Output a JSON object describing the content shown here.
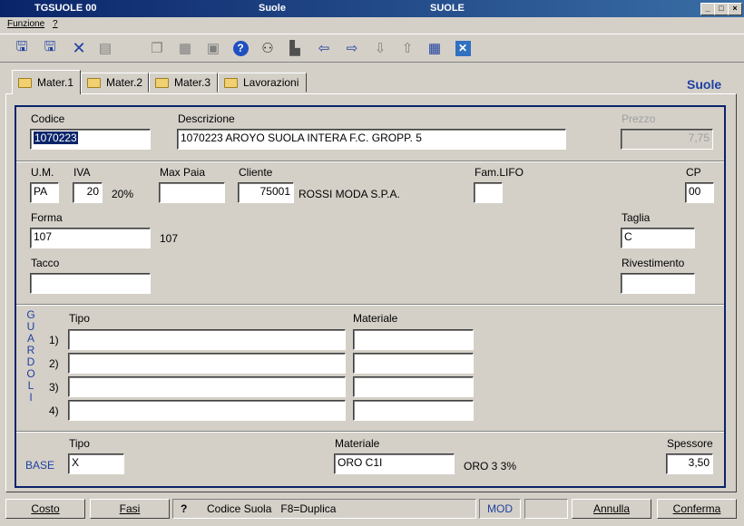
{
  "window": {
    "app_id": "TGSUOLE  00",
    "title_center": "Suole",
    "title_right": "SUOLE",
    "controls": {
      "minimize": "_",
      "maximize": "□",
      "close": "×"
    }
  },
  "menu": {
    "items": [
      "Funzione",
      "?"
    ]
  },
  "toolbar": {
    "icons": [
      "save-icon",
      "save-new-icon",
      "delete-icon",
      "print-icon",
      "copy-icon",
      "document-icon",
      "export-icon",
      "help-icon",
      "search-binoculars-icon",
      "filter-icon",
      "prev-icon",
      "next-icon",
      "down-icon",
      "up-icon",
      "calculator-icon",
      "close-icon"
    ]
  },
  "tabs": [
    {
      "label": "Mater.1",
      "active": true
    },
    {
      "label": "Mater.2",
      "active": false
    },
    {
      "label": "Mater.3",
      "active": false
    },
    {
      "label": "Lavorazioni",
      "active": false
    }
  ],
  "section_title": "Suole",
  "form": {
    "codice": {
      "label": "Codice",
      "value": "1070223"
    },
    "descrizione": {
      "label": "Descrizione",
      "value": "1070223 AROYO SUOLA INTERA F.C. GROPP. 5"
    },
    "prezzo": {
      "label": "Prezzo",
      "value": "7,75"
    },
    "um": {
      "label": "U.M.",
      "value": "PA"
    },
    "iva": {
      "label": "IVA",
      "value": "20",
      "desc": "20%"
    },
    "max_paia": {
      "label": "Max Paia",
      "value": ""
    },
    "cliente": {
      "label": "Cliente",
      "value": "75001",
      "desc": "ROSSI MODA S.P.A."
    },
    "fam_lifo": {
      "label": "Fam.LIFO",
      "value": ""
    },
    "cp": {
      "label": "CP",
      "value": "00"
    },
    "forma": {
      "label": "Forma",
      "value": "107",
      "desc": "107"
    },
    "taglia": {
      "label": "Taglia",
      "value": "C"
    },
    "tacco": {
      "label": "Tacco",
      "value": ""
    },
    "rivestimento": {
      "label": "Rivestimento",
      "value": ""
    }
  },
  "guardoli": {
    "side_label": [
      "G",
      "U",
      "A",
      "R",
      "D",
      "O",
      "L",
      "I"
    ],
    "tipo_header": "Tipo",
    "materiale_header": "Materiale",
    "rows": [
      {
        "num": "1)",
        "tipo": "",
        "materiale": ""
      },
      {
        "num": "2)",
        "tipo": "",
        "materiale": ""
      },
      {
        "num": "3)",
        "tipo": "",
        "materiale": ""
      },
      {
        "num": "4)",
        "tipo": "",
        "materiale": ""
      }
    ]
  },
  "base": {
    "label": "BASE",
    "tipo_label": "Tipo",
    "tipo_value": "X",
    "materiale_label": "Materiale",
    "materiale_value": "ORO C1I",
    "materiale_desc": "ORO 3 3%",
    "spessore_label": "Spessore",
    "spessore_value": "3,50"
  },
  "statusbar": {
    "costo": "Costo",
    "fasi": "Fasi",
    "help": "?",
    "message": "Codice Suola   F8=Duplica",
    "mode": "MOD",
    "annulla": "Annulla",
    "conferma": "Conferma"
  },
  "colors": {
    "titlebar": "#0a246a",
    "frame": "#0a246a",
    "face": "#d4d0c8",
    "accent_text": "#2040a0"
  }
}
